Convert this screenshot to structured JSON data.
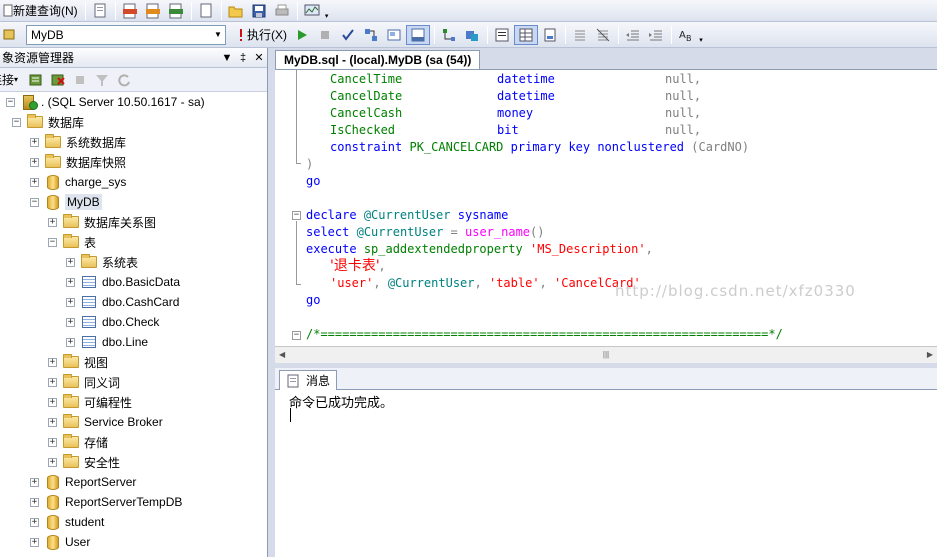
{
  "toolbar": {
    "new_query_label": "新建查询(N)",
    "database_select": "MyDB",
    "execute_label": "执行(X)"
  },
  "object_explorer": {
    "title": "象资源管理器",
    "connect_label": "连接",
    "tree": [
      {
        "label": ". (SQL Server 10.50.1617 - sa)",
        "level": 0,
        "icon": "server-icon",
        "expander": "-"
      },
      {
        "label": "数据库",
        "level": 1,
        "icon": "folder-icon",
        "expander": "-"
      },
      {
        "label": "系统数据库",
        "level": 2,
        "icon": "folder-icon",
        "expander": "+"
      },
      {
        "label": "数据库快照",
        "level": 2,
        "icon": "folder-icon",
        "expander": "+"
      },
      {
        "label": "charge_sys",
        "level": 2,
        "icon": "database-icon",
        "expander": "+"
      },
      {
        "label": "MyDB",
        "level": 2,
        "icon": "database-icon",
        "expander": "-",
        "selected": true
      },
      {
        "label": "数据库关系图",
        "level": 3,
        "icon": "folder-icon",
        "expander": "+"
      },
      {
        "label": "表",
        "level": 3,
        "icon": "folder-icon",
        "expander": "-"
      },
      {
        "label": "系统表",
        "level": 4,
        "icon": "folder-icon",
        "expander": "+"
      },
      {
        "label": "dbo.BasicData",
        "level": 4,
        "icon": "table-icon",
        "expander": "+"
      },
      {
        "label": "dbo.CashCard",
        "level": 4,
        "icon": "table-icon",
        "expander": "+"
      },
      {
        "label": "dbo.Check",
        "level": 4,
        "icon": "table-icon",
        "expander": "+"
      },
      {
        "label": "dbo.Line",
        "level": 4,
        "icon": "table-icon",
        "expander": "+"
      },
      {
        "label": "视图",
        "level": 3,
        "icon": "folder-icon",
        "expander": "+"
      },
      {
        "label": "同义词",
        "level": 3,
        "icon": "folder-icon",
        "expander": "+"
      },
      {
        "label": "可编程性",
        "level": 3,
        "icon": "folder-icon",
        "expander": "+"
      },
      {
        "label": "Service Broker",
        "level": 3,
        "icon": "folder-icon",
        "expander": "+"
      },
      {
        "label": "存储",
        "level": 3,
        "icon": "folder-icon",
        "expander": "+"
      },
      {
        "label": "安全性",
        "level": 3,
        "icon": "folder-icon",
        "expander": "+"
      },
      {
        "label": "ReportServer",
        "level": 2,
        "icon": "database-icon",
        "expander": "+"
      },
      {
        "label": "ReportServerTempDB",
        "level": 2,
        "icon": "database-icon",
        "expander": "+"
      },
      {
        "label": "student",
        "level": 2,
        "icon": "database-icon",
        "expander": "+"
      },
      {
        "label": "User",
        "level": 2,
        "icon": "database-icon",
        "expander": "+"
      }
    ]
  },
  "editor": {
    "tab_title": "MyDB.sql - (local).MyDB (sa (54))",
    "code": {
      "l1": {
        "a": "CancelTime",
        "b": "datetime",
        "c": "null,"
      },
      "l2": {
        "a": "CancelDate",
        "b": "datetime",
        "c": "null,"
      },
      "l3": {
        "a": "CancelCash",
        "b": "money",
        "c": "null,"
      },
      "l4": {
        "a": "IsChecked",
        "b": "bit",
        "c": "null,"
      },
      "l5": {
        "k1": "constraint",
        "n": "PK_CANCELCARD",
        "k2": "primary key nonclustered",
        "p": "(CardNO)"
      },
      "l6": ")",
      "l7": "go",
      "l9": {
        "k": "declare",
        "v": "@CurrentUser",
        "t": "sysname"
      },
      "l10": {
        "k": "select",
        "v": "@CurrentUser",
        "op": "=",
        "f": "user_name",
        "p": "()"
      },
      "l11": {
        "k": "execute",
        "sp": "sp_addextendedproperty",
        "s": "'MS_Description'",
        "c": ","
      },
      "l12": {
        "s": "'退卡表'",
        "c": ","
      },
      "l13": {
        "s1": "'user'",
        "v": "@CurrentUser",
        "s2": "'table'",
        "s3": "'CancelCard'"
      },
      "l14": "go",
      "l16": "/*==============================================================*/"
    },
    "watermark": "http://blog.csdn.net/xfz0330"
  },
  "results": {
    "tab_label": "消息",
    "message": "命令已成功完成。"
  }
}
